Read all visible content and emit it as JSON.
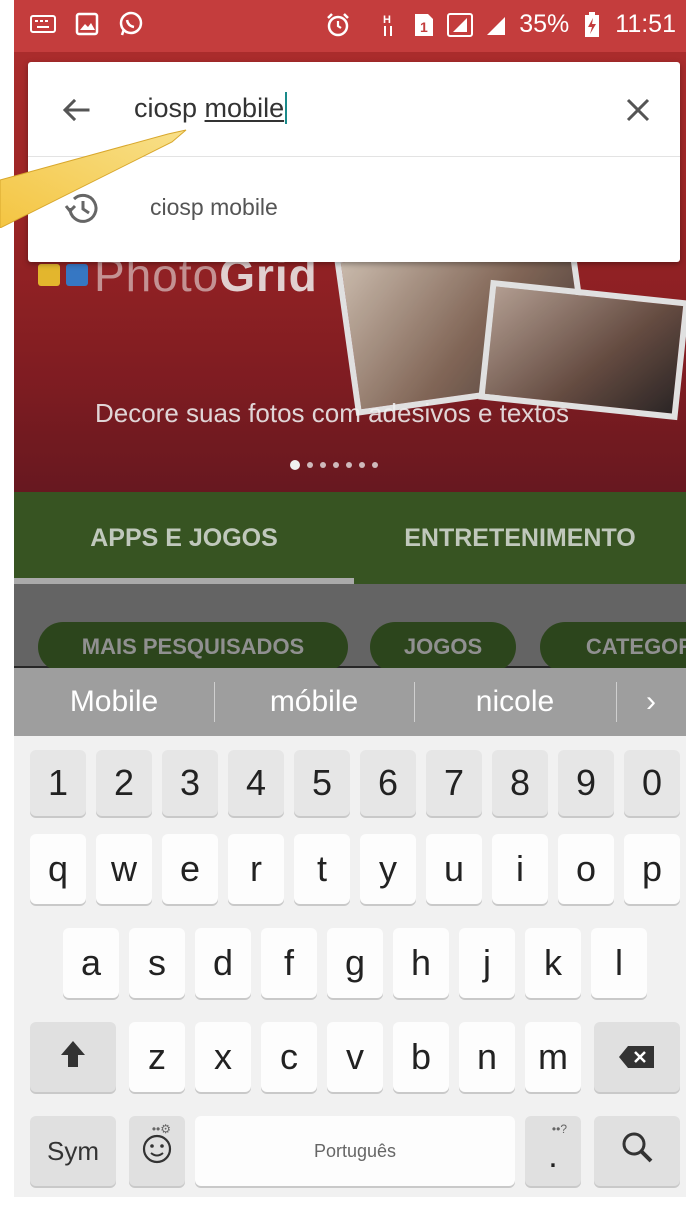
{
  "status_bar": {
    "battery": "35%",
    "time": "11:51",
    "sim_label": "1"
  },
  "search": {
    "query_prefix": "ciosp ",
    "query_underlined": "mobile",
    "suggestion": "ciosp mobile"
  },
  "banner": {
    "logo_light": "Photo",
    "logo_bold": "Grid",
    "caption": "Decore suas fotos com adesivos e textos"
  },
  "tabs": [
    {
      "label": "APPS E JOGOS"
    },
    {
      "label": "ENTRETENIMENTO"
    }
  ],
  "chips": [
    {
      "label": "MAIS PESQUISADOS"
    },
    {
      "label": "JOGOS"
    },
    {
      "label": "CATEGOR"
    }
  ],
  "keyboard": {
    "suggestions": [
      "Mobile",
      "móbile",
      "nicole",
      "›"
    ],
    "number_row": [
      "1",
      "2",
      "3",
      "4",
      "5",
      "6",
      "7",
      "8",
      "9",
      "0"
    ],
    "row1": [
      "q",
      "w",
      "e",
      "r",
      "t",
      "y",
      "u",
      "i",
      "o",
      "p"
    ],
    "row2": [
      "a",
      "s",
      "d",
      "f",
      "g",
      "h",
      "j",
      "k",
      "l"
    ],
    "row3": [
      "z",
      "x",
      "c",
      "v",
      "b",
      "n",
      "m"
    ],
    "sym_label": "Sym",
    "space_label": "Português",
    "period_label": ".",
    "period_hint": "••?",
    "emoji_hint": "••⚙"
  },
  "colors": {
    "status_bar": "#c43d3d",
    "tab_bar": "#3b5a25",
    "caret": "#1a8a8a"
  }
}
